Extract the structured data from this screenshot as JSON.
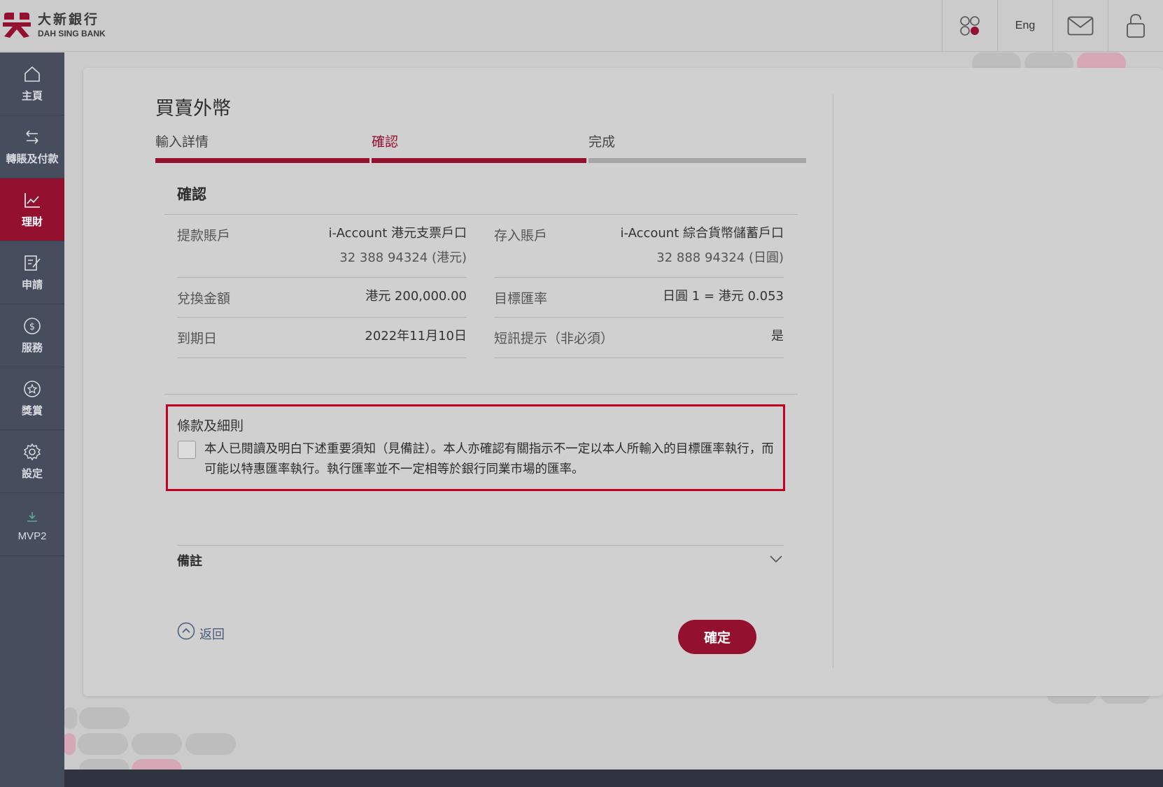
{
  "brand": {
    "name_cn": "大新銀行",
    "name_en": "DAH SING BANK",
    "color": "#93112f"
  },
  "header": {
    "lang_label": "Eng",
    "icons": [
      "apps-icon",
      "mail-icon",
      "lock-icon"
    ]
  },
  "sidebar": {
    "items": [
      {
        "label": "主頁",
        "icon": "home-icon"
      },
      {
        "label": "轉賬及付款",
        "icon": "transfer-icon"
      },
      {
        "label": "理財",
        "icon": "chart-icon",
        "active": true
      },
      {
        "label": "申請",
        "icon": "form-icon"
      },
      {
        "label": "服務",
        "icon": "dollar-icon"
      },
      {
        "label": "獎賞",
        "icon": "star-icon"
      },
      {
        "label": "設定",
        "icon": "gear-icon"
      },
      {
        "label": "MVP2",
        "icon": "download-icon"
      }
    ]
  },
  "page": {
    "title": "買賣外幣",
    "steps": [
      {
        "label": "輸入詳情",
        "state": "done"
      },
      {
        "label": "確認",
        "state": "active"
      },
      {
        "label": "完成",
        "state": "pending"
      }
    ],
    "section_title": "確認",
    "details": {
      "from_label": "提款賬戶",
      "from_account": "i-Account 港元支票戶口",
      "from_number": "32 388 94324 (港元)",
      "to_label": "存入賬戶",
      "to_account": "i-Account 綜合貨幣儲蓄戶口",
      "to_number": "32 888 94324 (日圓)",
      "amount_label": "兌換金額",
      "amount_value": "港元 200,000.00",
      "rate_label": "目標匯率",
      "rate_value": "日圓 1 = 港元 0.053",
      "expiry_label": "到期日",
      "expiry_value": "2022年11月10日",
      "sms_label": "短訊提示（非必須）",
      "sms_value": "是"
    },
    "terms": {
      "title": "條款及細則",
      "text": "本人已閱讀及明白下述重要須知（見備註）。本人亦確認有關指示不一定以本人所輸入的目標匯率執行，而可能以特惠匯率執行。執行匯率並不一定相等於銀行同業市場的匯率。",
      "checked": false
    },
    "notes_label": "備註",
    "back_label": "返回",
    "confirm_label": "確定"
  }
}
